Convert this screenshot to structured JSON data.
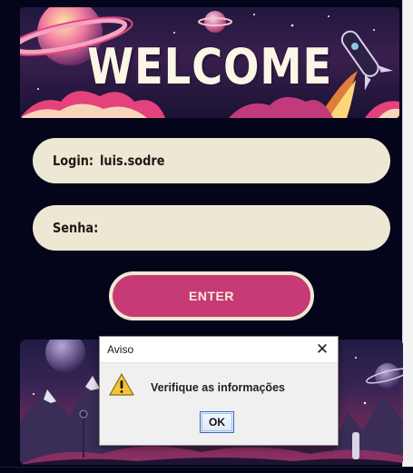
{
  "banner": {
    "title": "WELCOME"
  },
  "login": {
    "label": "Login:",
    "value": "luis.sodre"
  },
  "senha": {
    "label": "Senha:",
    "value": ""
  },
  "enter": {
    "label": "ENTER"
  },
  "dialog": {
    "title": "Aviso",
    "close_glyph": "✕",
    "message": "Verifique as informações",
    "ok_label": "OK",
    "icon": "warning-icon"
  },
  "colors": {
    "background": "#04051a",
    "field": "#ece8d4",
    "enter_button": "#c63b75",
    "enter_border": "#efe8d3"
  }
}
